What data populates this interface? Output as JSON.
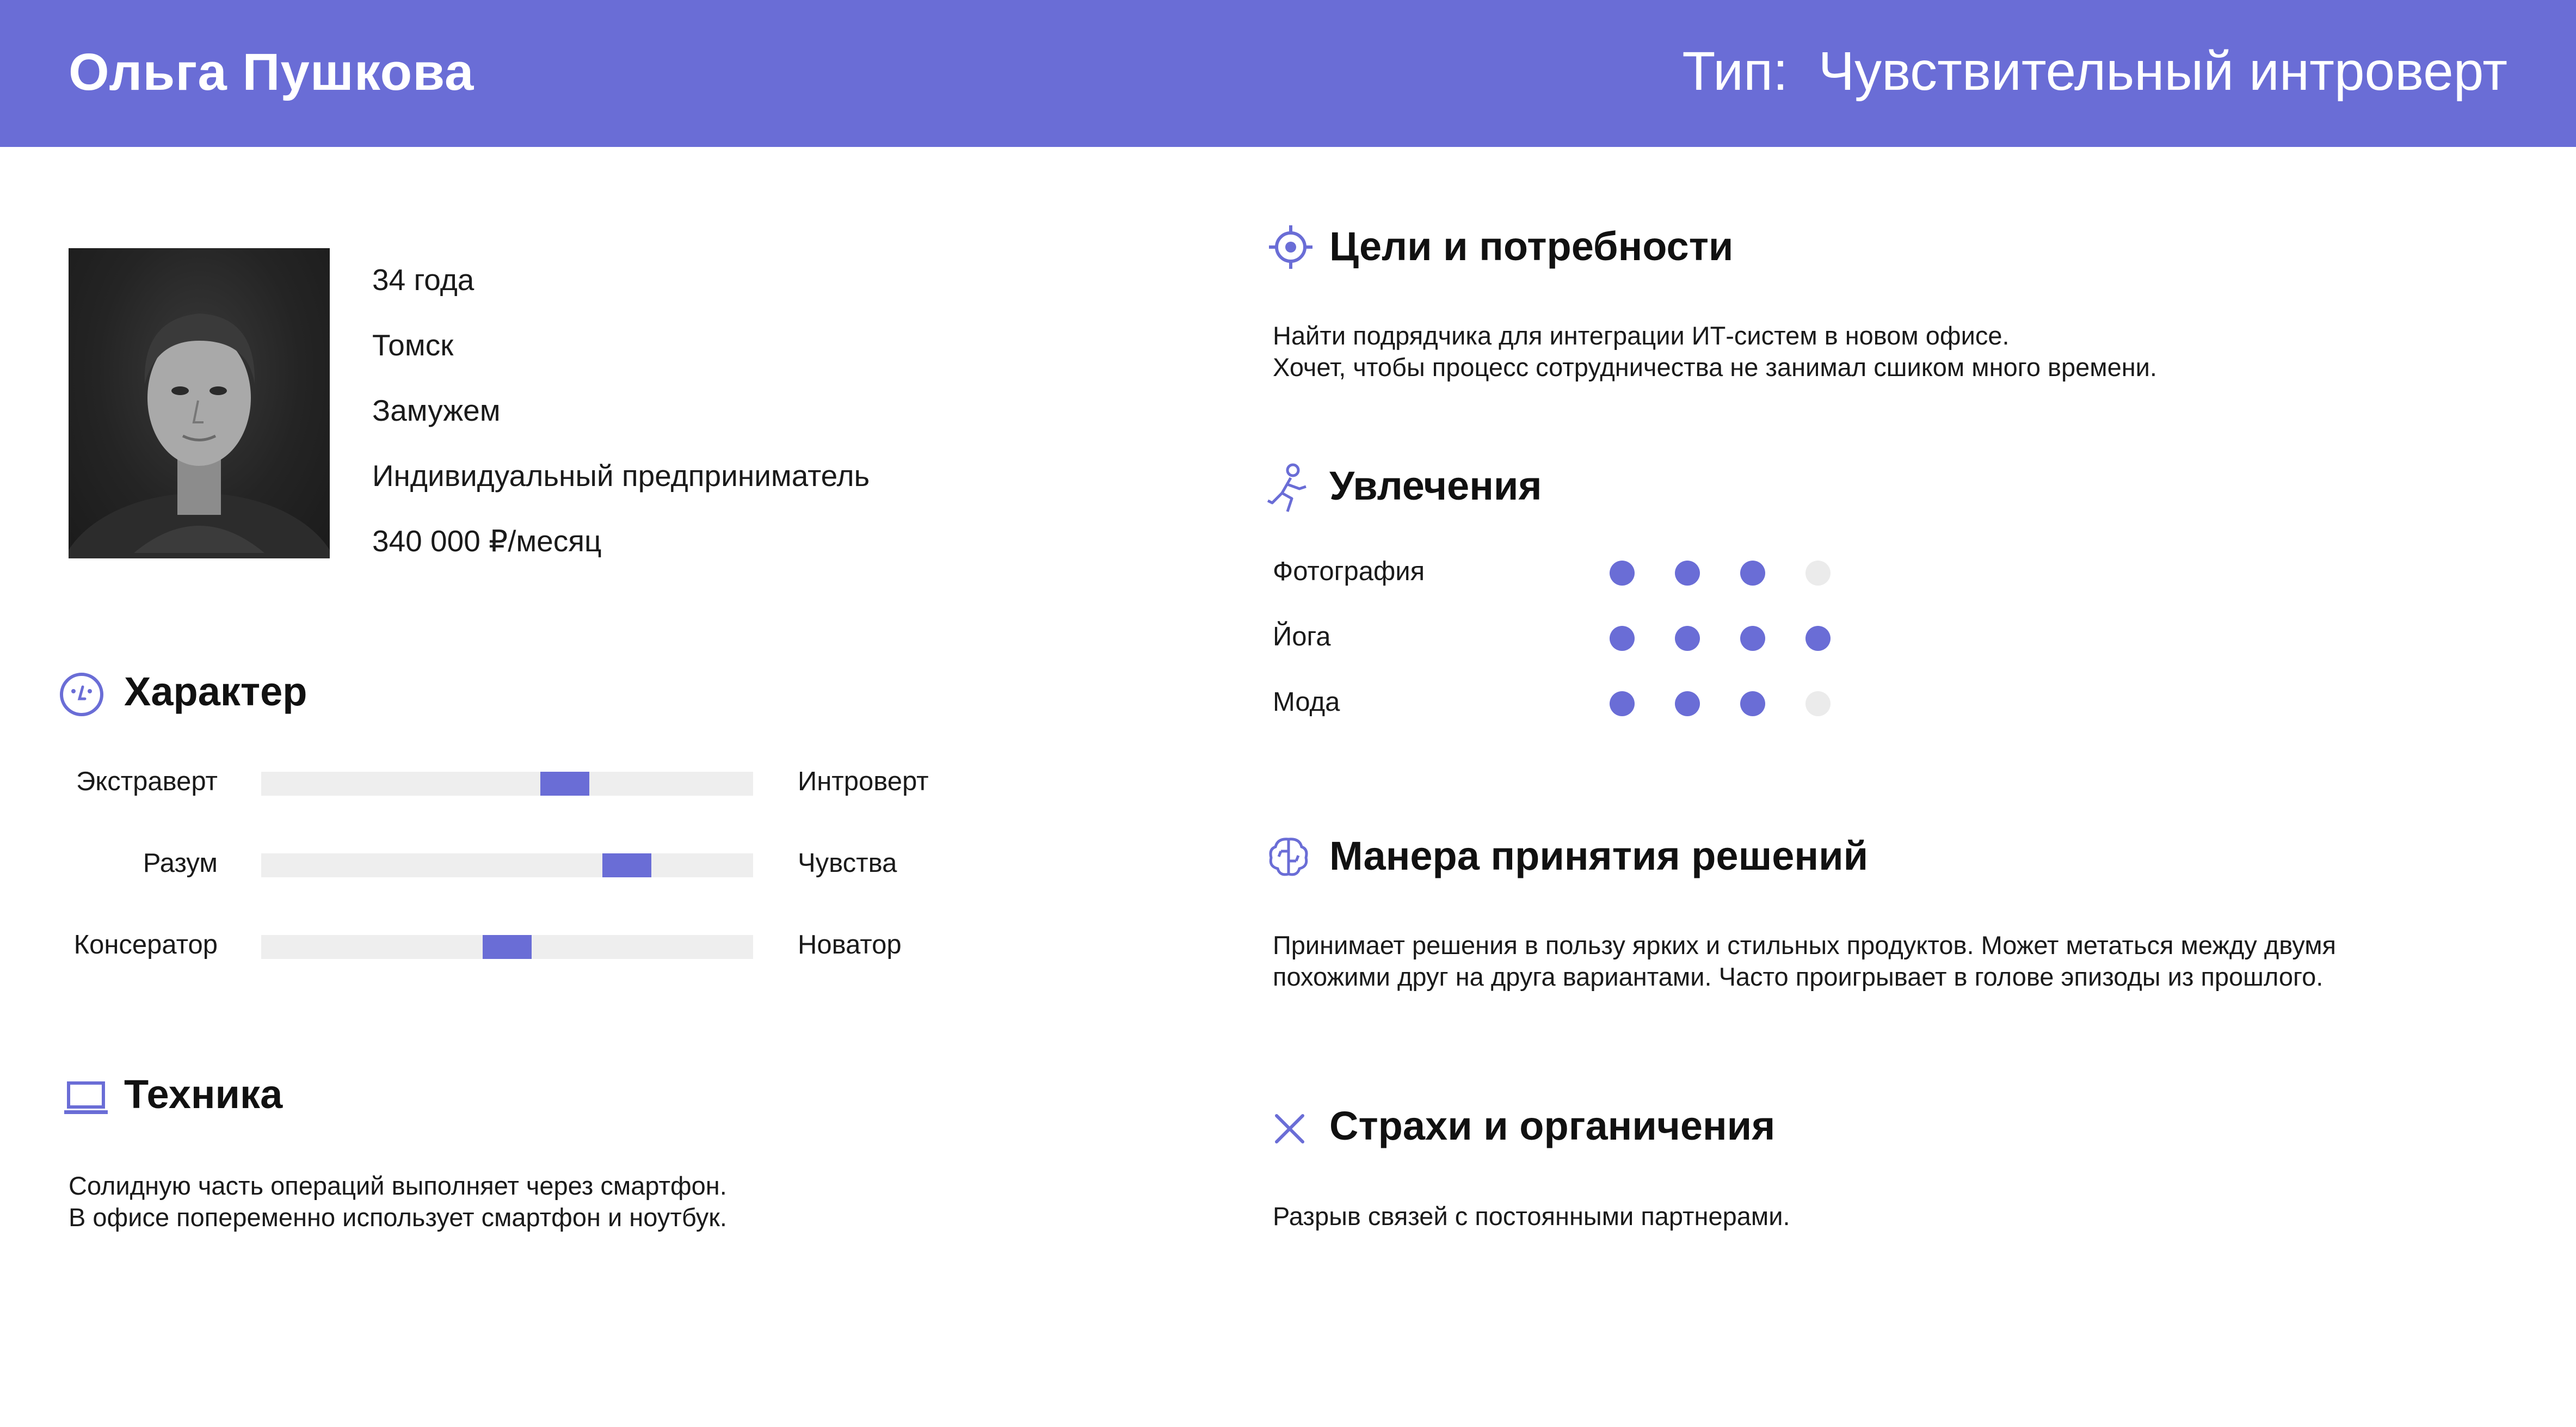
{
  "header": {
    "name": "Ольга Пушкова",
    "type_label": "Тип:  Чувствительный интроверт"
  },
  "profile": {
    "age": "34 года",
    "city": "Томск",
    "marital": "Замужем",
    "occupation": "Индивидуальный предприниматель",
    "income": "340 000 ₽/месяц"
  },
  "character": {
    "title": "Характер",
    "traits": [
      {
        "left": "Экстраверт",
        "right": "Интроверт",
        "value": 0.63
      },
      {
        "left": "Разум",
        "right": "Чувства",
        "value": 0.77
      },
      {
        "left": "Консератор",
        "right": "Новатор",
        "value": 0.5
      }
    ]
  },
  "tech": {
    "title": "Техника",
    "lines": [
      "Солидную часть операций выполняет через смартфон.",
      "В офисе попеременно использует смартфон и ноутбук."
    ]
  },
  "goals": {
    "title": "Цели и потребности",
    "lines": [
      "Найти подрядчика для интеграции ИТ-систем в новом офисе.",
      "Хочет, чтобы процесс сотрудничества не занимал сшиком много времени."
    ]
  },
  "hobbies": {
    "title": "Увлечения",
    "max": 4,
    "items": [
      {
        "label": "Фотография",
        "level": 3
      },
      {
        "label": "Йога",
        "level": 4
      },
      {
        "label": "Мода",
        "level": 3
      }
    ]
  },
  "decisions": {
    "title": "Манера принятия решений",
    "lines": [
      "Принимает решения в пользу ярких и стильных продуктов. Может метаться между двумя",
      "похожими друг на друга вариантами. Часто проигрывает в голове эпизоды из прошлого."
    ]
  },
  "fears": {
    "title": "Страхи и органичения",
    "lines": [
      "Разрыв связей с постоянными партнерами."
    ]
  },
  "colors": {
    "accent": "#6a6dd6",
    "track": "#eeeeee",
    "dot_off": "#ebebeb"
  }
}
